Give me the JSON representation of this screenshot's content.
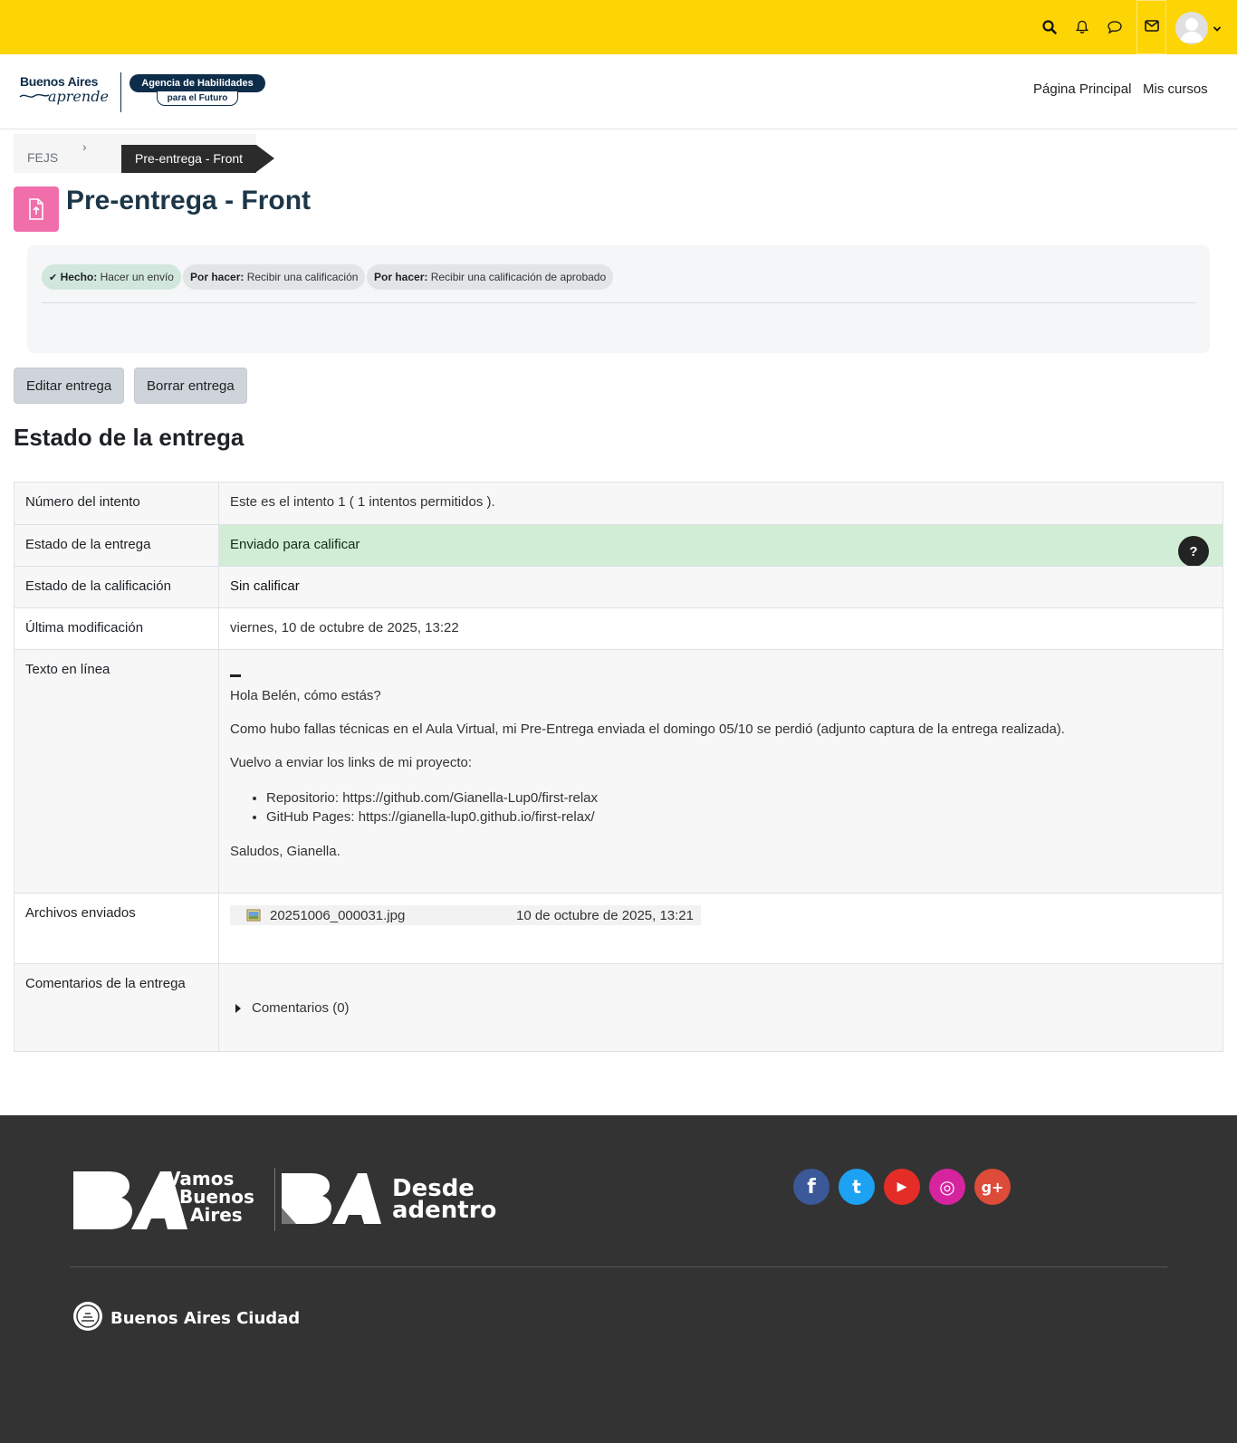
{
  "topbar": {
    "icons": [
      "search-icon",
      "bell-icon",
      "chat-icon",
      "envelope-icon",
      "avatar",
      "chevron-down-icon"
    ],
    "bg": "#fdd404"
  },
  "header": {
    "logo_text_1": "Buenos Aires",
    "logo_text_2": "aprende",
    "logo_badge_1": "Agencia de Habilidades",
    "logo_badge_2": "para el Futuro",
    "nav": [
      "Página Principal",
      "Mis cursos"
    ]
  },
  "breadcrumb": {
    "items": [
      "FEJS"
    ],
    "separator": "›",
    "current": "Pre-entrega - Front"
  },
  "page": {
    "title": "Pre-entrega - Front",
    "icon_color": "#f06eaa"
  },
  "completion": [
    {
      "status": "Hecho:",
      "text": "Hacer un envío",
      "done": true
    },
    {
      "status": "Por hacer:",
      "text": "Recibir una calificación",
      "done": false
    },
    {
      "status": "Por hacer:",
      "text": "Recibir una calificación de aprobado",
      "done": false
    }
  ],
  "actions": {
    "edit": "Editar entrega",
    "delete": "Borrar entrega"
  },
  "status_section": {
    "heading": "Estado de la entrega",
    "rows": {
      "attempt": {
        "label": "Número del intento",
        "value": "Este es el intento 1 ( 1 intentos permitidos )."
      },
      "submission": {
        "label": "Estado de la entrega",
        "value": "Enviado para calificar",
        "help": "?"
      },
      "grading": {
        "label": "Estado de la calificación",
        "value": "Sin calificar"
      },
      "modified": {
        "label": "Última modificación",
        "value": "viernes, 10 de octubre de 2025, 13:22"
      },
      "online_text": {
        "label": "Texto en línea",
        "p1": "Hola Belén, cómo estás?",
        "p2": "Como hubo fallas técnicas en el Aula Virtual, mi Pre-Entrega enviada el domingo 05/10 se perdió (adjunto captura de la entrega realizada).",
        "p3": "Vuelvo a enviar los links de mi proyecto:",
        "links": [
          "Repositorio: https://github.com/Gianella-Lup0/first-relax",
          "GitHub Pages: https://gianella-lup0.github.io/first-relax/"
        ],
        "p4": "Saludos, Gianella."
      },
      "files": {
        "label": "Archivos enviados",
        "file_name": "20251006_000031.jpg",
        "file_date": "10 de octubre de 2025, 13:21"
      },
      "comments": {
        "label": "Comentarios de la entrega",
        "toggle": "Comentarios (0)"
      }
    }
  },
  "footer": {
    "brand1_line1": "Vamos",
    "brand1_line2": "Buenos",
    "brand1_line3": "Aires",
    "brand2_line1": "Desde",
    "brand2_line2": "adentro",
    "city": "Buenos Aires Ciudad",
    "social": [
      {
        "name": "facebook-icon",
        "glyph": "f",
        "color": "#3b5998"
      },
      {
        "name": "twitter-icon",
        "glyph": "t",
        "color": "#1da1f2"
      },
      {
        "name": "youtube-icon",
        "glyph": "▶",
        "color": "#e52d27"
      },
      {
        "name": "instagram-icon",
        "glyph": "◎",
        "color": "#d6249f"
      },
      {
        "name": "googleplus-icon",
        "glyph": "g+",
        "color": "#dd4b39"
      }
    ]
  }
}
